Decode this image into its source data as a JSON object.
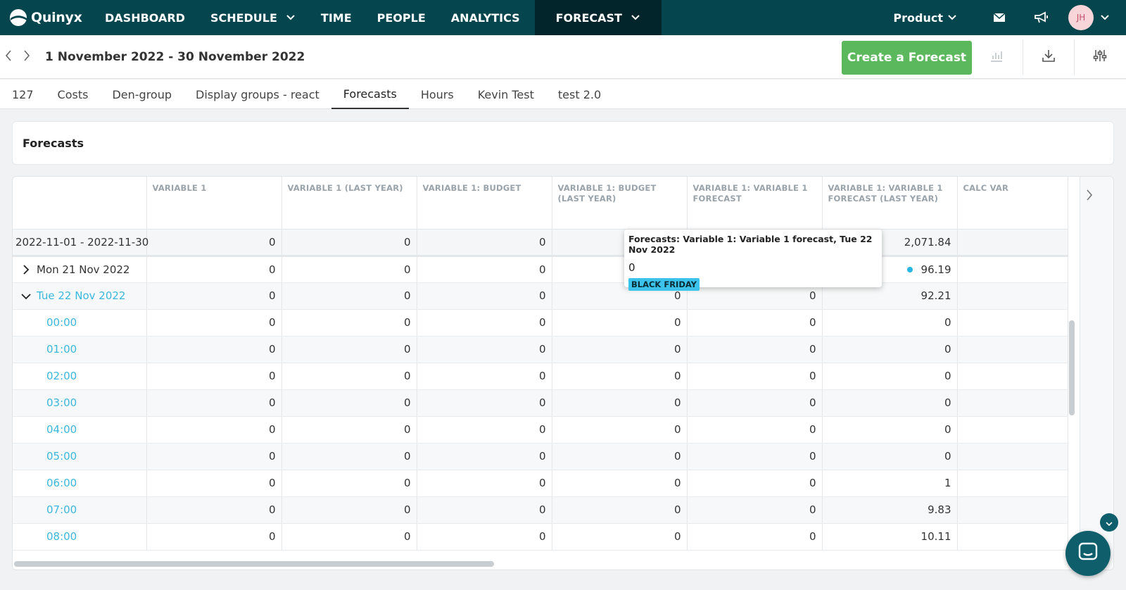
{
  "app": {
    "name": "Quinyx"
  },
  "nav": {
    "items": [
      {
        "label": "DASHBOARD",
        "dropdown": false
      },
      {
        "label": "SCHEDULE",
        "dropdown": true
      },
      {
        "label": "TIME",
        "dropdown": false
      },
      {
        "label": "PEOPLE",
        "dropdown": false
      },
      {
        "label": "ANALYTICS",
        "dropdown": false
      },
      {
        "label": "FORECAST",
        "dropdown": true,
        "active": true
      }
    ],
    "product": "Product",
    "avatar_initials": "JH"
  },
  "header": {
    "date_range": "1 November 2022 - 30 November 2022",
    "create_button": "Create a Forecast"
  },
  "tabs": [
    {
      "label": "127"
    },
    {
      "label": "Costs"
    },
    {
      "label": "Den-group"
    },
    {
      "label": "Display groups - react"
    },
    {
      "label": "Forecasts",
      "active": true
    },
    {
      "label": "Hours"
    },
    {
      "label": "Kevin Test"
    },
    {
      "label": "test 2.0"
    }
  ],
  "panel": {
    "title": "Forecasts"
  },
  "grid": {
    "columns": [
      "",
      "VARIABLE 1",
      "VARIABLE 1 (LAST YEAR)",
      "VARIABLE 1: BUDGET",
      "VARIABLE 1: BUDGET (LAST YEAR)",
      "VARIABLE 1: VARIABLE 1 FORECAST",
      "VARIABLE 1: VARIABLE 1 FORECAST (LAST YEAR)",
      "CALC VAR"
    ],
    "rows": [
      {
        "label": "2022-11-01 - 2022-11-30",
        "values": [
          "0",
          "0",
          "0",
          "",
          "",
          "2,071.84",
          ""
        ]
      },
      {
        "label": "Mon 21 Nov 2022",
        "values": [
          "0",
          "0",
          "0",
          "",
          "",
          "96.19",
          ""
        ]
      },
      {
        "label": "Tue 22 Nov 2022",
        "values": [
          "0",
          "0",
          "0",
          "0",
          "0",
          "92.21",
          ""
        ]
      },
      {
        "label": "00:00",
        "values": [
          "0",
          "0",
          "0",
          "0",
          "0",
          "0",
          ""
        ]
      },
      {
        "label": "01:00",
        "values": [
          "0",
          "0",
          "0",
          "0",
          "0",
          "0",
          ""
        ]
      },
      {
        "label": "02:00",
        "values": [
          "0",
          "0",
          "0",
          "0",
          "0",
          "0",
          ""
        ]
      },
      {
        "label": "03:00",
        "values": [
          "0",
          "0",
          "0",
          "0",
          "0",
          "0",
          ""
        ]
      },
      {
        "label": "04:00",
        "values": [
          "0",
          "0",
          "0",
          "0",
          "0",
          "0",
          ""
        ]
      },
      {
        "label": "05:00",
        "values": [
          "0",
          "0",
          "0",
          "0",
          "0",
          "0",
          ""
        ]
      },
      {
        "label": "06:00",
        "values": [
          "0",
          "0",
          "0",
          "0",
          "0",
          "1",
          ""
        ]
      },
      {
        "label": "07:00",
        "values": [
          "0",
          "0",
          "0",
          "0",
          "0",
          "9.83",
          ""
        ]
      },
      {
        "label": "08:00",
        "values": [
          "0",
          "0",
          "0",
          "0",
          "0",
          "10.11",
          ""
        ]
      }
    ]
  },
  "tooltip": {
    "title": "Forecasts: Variable 1: Variable 1 forecast, Tue 22 Nov 2022",
    "value": "0",
    "badge": "BLACK FRIDAY"
  },
  "colors": {
    "nav_bg": "#05454e",
    "nav_active": "#02252b",
    "accent_green": "#5cb85c",
    "link": "#3ab7dc"
  }
}
